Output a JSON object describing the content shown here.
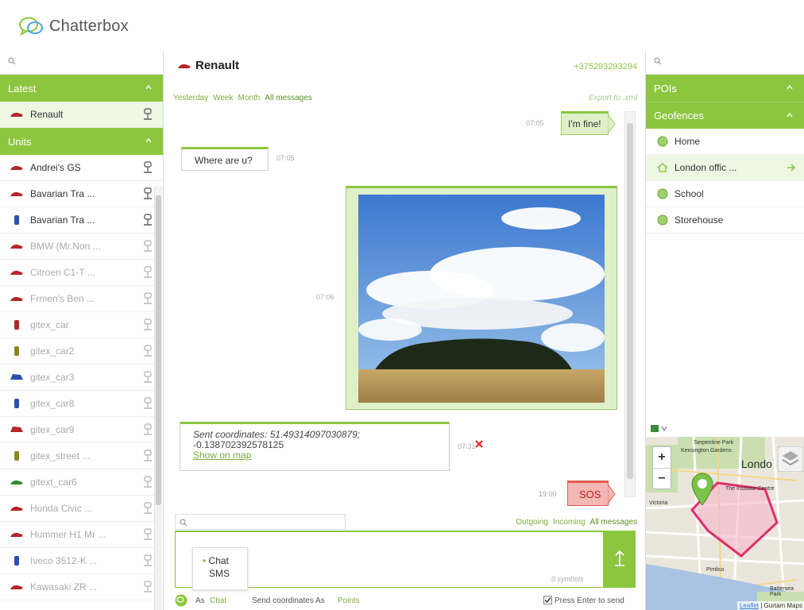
{
  "app": {
    "name": "Chatterbox"
  },
  "left_panel": {
    "search_placeholder": "",
    "latest_header": "Latest",
    "latest_items": [
      {
        "label": "Renault",
        "active": true
      }
    ],
    "units_header": "Units",
    "units": [
      {
        "label": "Andrei's GS",
        "dim": false,
        "color": "#b3262a",
        "kind": "car"
      },
      {
        "label": "Bavarian Tra ...",
        "dim": false,
        "color": "#b3262a",
        "kind": "car"
      },
      {
        "label": "Bavarian Tra ...",
        "dim": false,
        "color": "#2a4fb0",
        "kind": "bottle"
      },
      {
        "label": "BMW (Mr.Non ...",
        "dim": true,
        "color": "#b3262a",
        "kind": "car"
      },
      {
        "label": "Citroen C1-T ...",
        "dim": true,
        "color": "#b3262a",
        "kind": "car"
      },
      {
        "label": "Frmen's Ben ...",
        "dim": true,
        "color": "#b3262a",
        "kind": "car"
      },
      {
        "label": "gitex_car",
        "dim": true,
        "color": "#b3262a",
        "kind": "bottle"
      },
      {
        "label": "gitex_car2",
        "dim": true,
        "color": "#8a8a20",
        "kind": "bottle"
      },
      {
        "label": "gitex_car3",
        "dim": true,
        "color": "#2a4fb0",
        "kind": "truck"
      },
      {
        "label": "gitex_car8",
        "dim": true,
        "color": "#2a4fb0",
        "kind": "bottle"
      },
      {
        "label": "gitex_car9",
        "dim": true,
        "color": "#b3262a",
        "kind": "truck"
      },
      {
        "label": "gitex_street ...",
        "dim": true,
        "color": "#8a8a20",
        "kind": "bottle"
      },
      {
        "label": "gitext_car6",
        "dim": true,
        "color": "#2f8a2f",
        "kind": "car"
      },
      {
        "label": "Honda Civic ...",
        "dim": true,
        "color": "#b3262a",
        "kind": "car"
      },
      {
        "label": "Hummer H1 Mr ...",
        "dim": true,
        "color": "#b3262a",
        "kind": "car"
      },
      {
        "label": "Iveco 3512-K ...",
        "dim": true,
        "color": "#2a4fb0",
        "kind": "bottle"
      },
      {
        "label": "Kawasaki ZR ...",
        "dim": true,
        "color": "#b3262a",
        "kind": "car"
      }
    ]
  },
  "chat": {
    "title": "Renault",
    "phone": "+375293293294",
    "filters": [
      "Yesterday",
      "Week",
      "Month",
      "All messages"
    ],
    "export_label": "Export to .xml",
    "messages": {
      "m1_text": "I'm fine!",
      "m1_time": "07:05",
      "m2_text": "Where are u?",
      "m2_time": "07:05",
      "m3_time": "07:06",
      "m4_line1": "Sent coordinates: 51.49314097030879;",
      "m4_line2": "-0.138702392578125",
      "m4_link": "Show on map",
      "m4_time": "07:31",
      "m5_text": "SOS",
      "m5_time": "19:00"
    },
    "search_placeholder": "",
    "msg_filters": [
      "Outgoing",
      "Incoming",
      "All messages"
    ],
    "compose": {
      "mode_options": [
        "Chat",
        "SMS"
      ],
      "symbols": "0 symbols"
    },
    "bottom": {
      "as_label": "As",
      "as_value": "Chat",
      "send_coords_label": "Send coordinates As",
      "send_coords_value": "Points",
      "press_enter_label": "Press Enter to send",
      "press_enter_checked": true
    }
  },
  "right_panel": {
    "search_placeholder": "",
    "pois_header": "POIs",
    "geofences_header": "Geofences",
    "geofences": [
      {
        "label": "Home",
        "active": false,
        "icon": "circle"
      },
      {
        "label": "London offic ...",
        "active": true,
        "icon": "house"
      },
      {
        "label": "School",
        "active": false,
        "icon": "circle"
      },
      {
        "label": "Storehouse",
        "active": false,
        "icon": "circle"
      }
    ],
    "map": {
      "label_park": "Serpentine Park",
      "label_garden": "Kensington Gardens",
      "label_city": "Londo",
      "label_centre": "The Institute Centre",
      "label_pimlico": "Pimlico",
      "label_victoria": "Victoria",
      "label_battersea": "Battersea Park",
      "attrib_leaflet": "Leaflet",
      "attrib_rest": "| Gurtam Maps"
    }
  },
  "colors": {
    "accent": "#8cc63f",
    "accent_dark": "#5a8f22",
    "sos_bg": "#f3b7b4",
    "sos_border": "#e15b52"
  }
}
